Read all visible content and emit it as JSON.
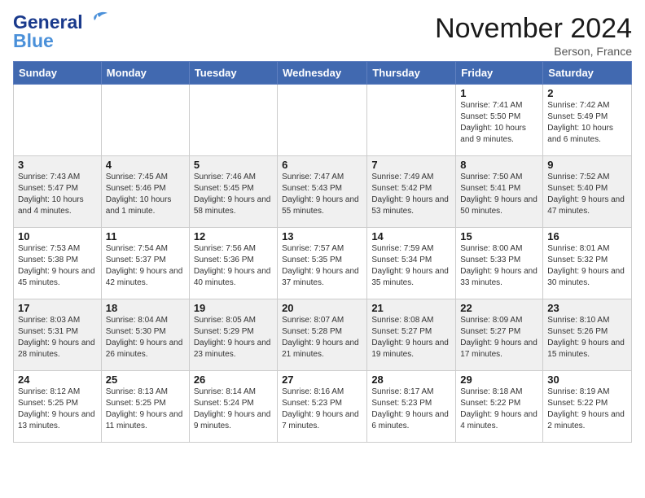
{
  "header": {
    "logo_general": "General",
    "logo_blue": "Blue",
    "month_title": "November 2024",
    "subtitle": "Berson, France"
  },
  "calendar": {
    "days_of_week": [
      "Sunday",
      "Monday",
      "Tuesday",
      "Wednesday",
      "Thursday",
      "Friday",
      "Saturday"
    ],
    "weeks": [
      [
        {
          "day": "",
          "info": ""
        },
        {
          "day": "",
          "info": ""
        },
        {
          "day": "",
          "info": ""
        },
        {
          "day": "",
          "info": ""
        },
        {
          "day": "",
          "info": ""
        },
        {
          "day": "1",
          "info": "Sunrise: 7:41 AM\nSunset: 5:50 PM\nDaylight: 10 hours and 9 minutes."
        },
        {
          "day": "2",
          "info": "Sunrise: 7:42 AM\nSunset: 5:49 PM\nDaylight: 10 hours and 6 minutes."
        }
      ],
      [
        {
          "day": "3",
          "info": "Sunrise: 7:43 AM\nSunset: 5:47 PM\nDaylight: 10 hours and 4 minutes."
        },
        {
          "day": "4",
          "info": "Sunrise: 7:45 AM\nSunset: 5:46 PM\nDaylight: 10 hours and 1 minute."
        },
        {
          "day": "5",
          "info": "Sunrise: 7:46 AM\nSunset: 5:45 PM\nDaylight: 9 hours and 58 minutes."
        },
        {
          "day": "6",
          "info": "Sunrise: 7:47 AM\nSunset: 5:43 PM\nDaylight: 9 hours and 55 minutes."
        },
        {
          "day": "7",
          "info": "Sunrise: 7:49 AM\nSunset: 5:42 PM\nDaylight: 9 hours and 53 minutes."
        },
        {
          "day": "8",
          "info": "Sunrise: 7:50 AM\nSunset: 5:41 PM\nDaylight: 9 hours and 50 minutes."
        },
        {
          "day": "9",
          "info": "Sunrise: 7:52 AM\nSunset: 5:40 PM\nDaylight: 9 hours and 47 minutes."
        }
      ],
      [
        {
          "day": "10",
          "info": "Sunrise: 7:53 AM\nSunset: 5:38 PM\nDaylight: 9 hours and 45 minutes."
        },
        {
          "day": "11",
          "info": "Sunrise: 7:54 AM\nSunset: 5:37 PM\nDaylight: 9 hours and 42 minutes."
        },
        {
          "day": "12",
          "info": "Sunrise: 7:56 AM\nSunset: 5:36 PM\nDaylight: 9 hours and 40 minutes."
        },
        {
          "day": "13",
          "info": "Sunrise: 7:57 AM\nSunset: 5:35 PM\nDaylight: 9 hours and 37 minutes."
        },
        {
          "day": "14",
          "info": "Sunrise: 7:59 AM\nSunset: 5:34 PM\nDaylight: 9 hours and 35 minutes."
        },
        {
          "day": "15",
          "info": "Sunrise: 8:00 AM\nSunset: 5:33 PM\nDaylight: 9 hours and 33 minutes."
        },
        {
          "day": "16",
          "info": "Sunrise: 8:01 AM\nSunset: 5:32 PM\nDaylight: 9 hours and 30 minutes."
        }
      ],
      [
        {
          "day": "17",
          "info": "Sunrise: 8:03 AM\nSunset: 5:31 PM\nDaylight: 9 hours and 28 minutes."
        },
        {
          "day": "18",
          "info": "Sunrise: 8:04 AM\nSunset: 5:30 PM\nDaylight: 9 hours and 26 minutes."
        },
        {
          "day": "19",
          "info": "Sunrise: 8:05 AM\nSunset: 5:29 PM\nDaylight: 9 hours and 23 minutes."
        },
        {
          "day": "20",
          "info": "Sunrise: 8:07 AM\nSunset: 5:28 PM\nDaylight: 9 hours and 21 minutes."
        },
        {
          "day": "21",
          "info": "Sunrise: 8:08 AM\nSunset: 5:27 PM\nDaylight: 9 hours and 19 minutes."
        },
        {
          "day": "22",
          "info": "Sunrise: 8:09 AM\nSunset: 5:27 PM\nDaylight: 9 hours and 17 minutes."
        },
        {
          "day": "23",
          "info": "Sunrise: 8:10 AM\nSunset: 5:26 PM\nDaylight: 9 hours and 15 minutes."
        }
      ],
      [
        {
          "day": "24",
          "info": "Sunrise: 8:12 AM\nSunset: 5:25 PM\nDaylight: 9 hours and 13 minutes."
        },
        {
          "day": "25",
          "info": "Sunrise: 8:13 AM\nSunset: 5:25 PM\nDaylight: 9 hours and 11 minutes."
        },
        {
          "day": "26",
          "info": "Sunrise: 8:14 AM\nSunset: 5:24 PM\nDaylight: 9 hours and 9 minutes."
        },
        {
          "day": "27",
          "info": "Sunrise: 8:16 AM\nSunset: 5:23 PM\nDaylight: 9 hours and 7 minutes."
        },
        {
          "day": "28",
          "info": "Sunrise: 8:17 AM\nSunset: 5:23 PM\nDaylight: 9 hours and 6 minutes."
        },
        {
          "day": "29",
          "info": "Sunrise: 8:18 AM\nSunset: 5:22 PM\nDaylight: 9 hours and 4 minutes."
        },
        {
          "day": "30",
          "info": "Sunrise: 8:19 AM\nSunset: 5:22 PM\nDaylight: 9 hours and 2 minutes."
        }
      ]
    ]
  }
}
